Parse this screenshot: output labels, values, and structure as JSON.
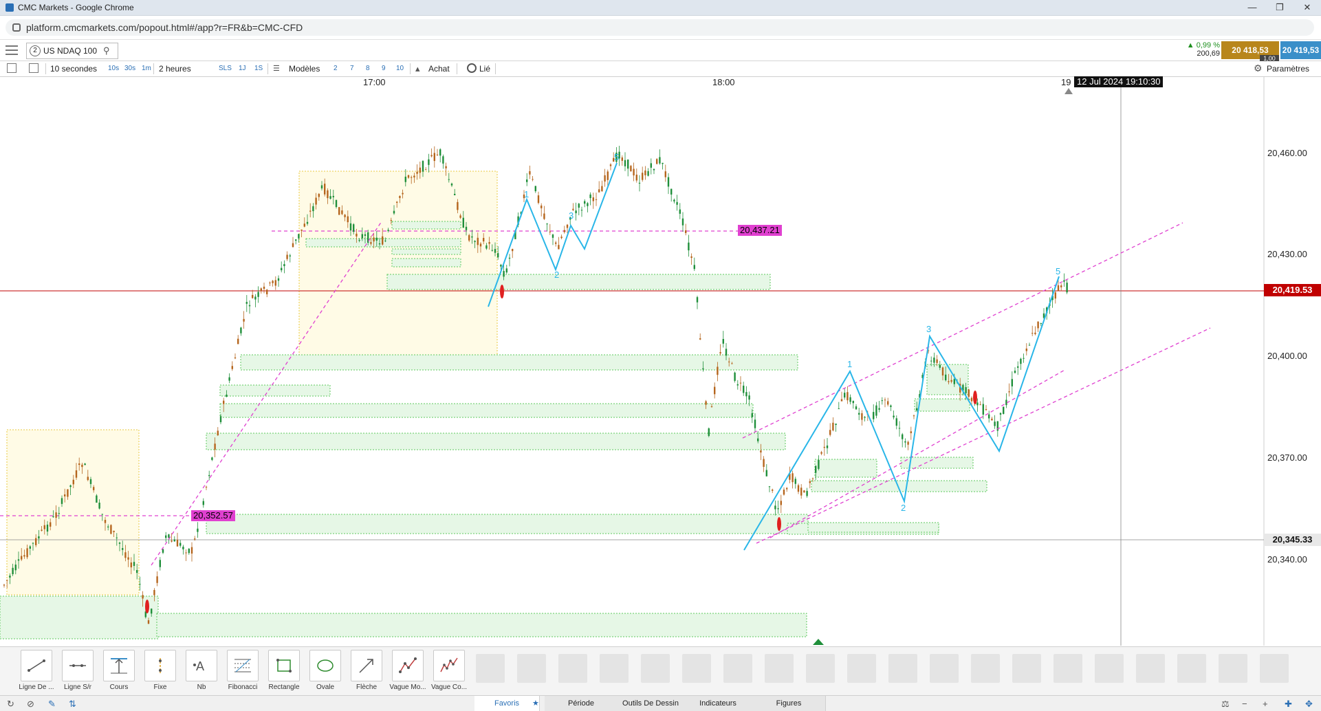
{
  "window": {
    "title": "CMC Markets - Google Chrome",
    "min": "—",
    "restore": "❐",
    "close": "✕"
  },
  "browser": {
    "url": "platform.cmcmarkets.com/popout.html#/app?r=FR&b=CMC-CFD"
  },
  "instrument": {
    "number": "2",
    "name": "US NDAQ 100"
  },
  "quote": {
    "change_pct": "▲ 0,99 %",
    "change_pts": "200,69",
    "sell": "20 418,53",
    "buy": "20 419,53",
    "lot": "1,00"
  },
  "toolbar": {
    "interval": "10 secondes",
    "intervals": [
      "10s",
      "30s",
      "1m"
    ],
    "range": "2 heures",
    "ranges": [
      "SLS",
      "1J",
      "1S"
    ],
    "templates": "Modèles",
    "counts": [
      "2",
      "7",
      "8",
      "9",
      "10"
    ],
    "buy": "Achat",
    "link": "Lié",
    "settings": "Paramètres"
  },
  "chart": {
    "time_labels": [
      "17:00",
      "18:00",
      "19"
    ],
    "crosshair_time": "12 Jul 2024 19:10:30",
    "price_labels": [
      "20,460.00",
      "20,430.00",
      "20,400.00",
      "20,370.00",
      "20,340.00"
    ],
    "current_price": "20,419.53",
    "crosshair_price": "20,345.33",
    "level_upper": "20,437.21",
    "level_lower": "20,352.57",
    "wave_labels_left": [
      "1",
      "2",
      "3",
      "5"
    ],
    "wave_labels_right": [
      "1",
      "2",
      "3",
      "5"
    ],
    "colors": {
      "up": "#1f8f3a",
      "down": "#b5651d",
      "current": "#c00000",
      "magenta": "#e040d0",
      "wave": "#29b6e8",
      "zone": "#e6f7e6",
      "range": "#fffbe6"
    }
  },
  "tools": [
    {
      "label": "Ligne De ...",
      "icon": "line-icon"
    },
    {
      "label": "Ligne S/r",
      "icon": "sr-line-icon"
    },
    {
      "label": "Cours",
      "icon": "price-icon"
    },
    {
      "label": "Fixe",
      "icon": "fixed-icon"
    },
    {
      "label": "Nb",
      "icon": "text-icon"
    },
    {
      "label": "Fibonacci",
      "icon": "fibonacci-icon"
    },
    {
      "label": "Rectangle",
      "icon": "rectangle-icon"
    },
    {
      "label": "Ovale",
      "icon": "oval-icon"
    },
    {
      "label": "Flèche",
      "icon": "arrow-icon"
    },
    {
      "label": "Vague Mo...",
      "icon": "wave-icon"
    },
    {
      "label": "Vague Co...",
      "icon": "wave2-icon"
    }
  ],
  "tabs": [
    "Favoris",
    "Période",
    "Outils De Dessin",
    "Indicateurs",
    "Figures"
  ]
}
